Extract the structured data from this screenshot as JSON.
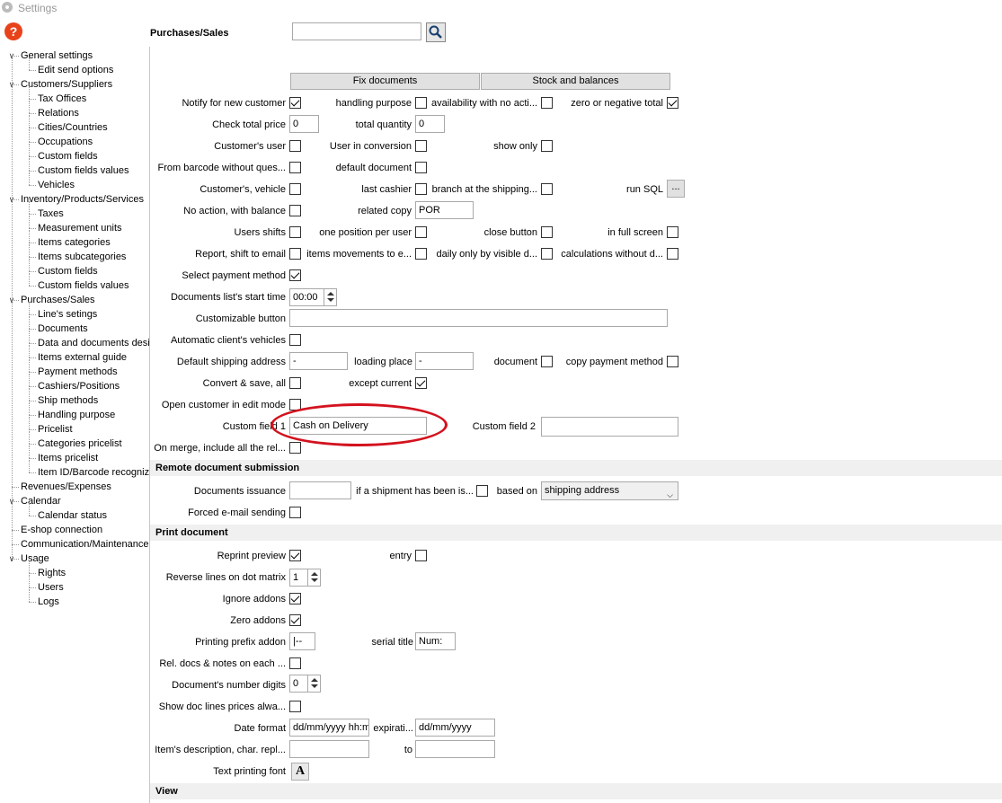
{
  "window": {
    "title": "Settings",
    "help_label": "?"
  },
  "sidebar": {
    "items": [
      {
        "label": "General settings",
        "level": 0,
        "expanded": true
      },
      {
        "label": "Edit send options",
        "level": 1
      },
      {
        "label": "Customers/Suppliers",
        "level": 0,
        "expanded": true
      },
      {
        "label": "Tax Offices",
        "level": 1
      },
      {
        "label": "Relations",
        "level": 1
      },
      {
        "label": "Cities/Countries",
        "level": 1
      },
      {
        "label": "Occupations",
        "level": 1
      },
      {
        "label": "Custom fields",
        "level": 1
      },
      {
        "label": "Custom fields values",
        "level": 1
      },
      {
        "label": "Vehicles",
        "level": 1
      },
      {
        "label": "Inventory/Products/Services",
        "level": 0,
        "expanded": true
      },
      {
        "label": "Taxes",
        "level": 1
      },
      {
        "label": "Measurement units",
        "level": 1
      },
      {
        "label": "Items categories",
        "level": 1
      },
      {
        "label": "Items subcategories",
        "level": 1
      },
      {
        "label": "Custom fields",
        "level": 1
      },
      {
        "label": "Custom fields values",
        "level": 1
      },
      {
        "label": "Purchases/Sales",
        "level": 0,
        "expanded": true
      },
      {
        "label": "Line's setings",
        "level": 1
      },
      {
        "label": "Documents",
        "level": 1
      },
      {
        "label": "Data and documents desi",
        "level": 1
      },
      {
        "label": "Items external guide",
        "level": 1
      },
      {
        "label": "Payment methods",
        "level": 1
      },
      {
        "label": "Cashiers/Positions",
        "level": 1
      },
      {
        "label": "Ship methods",
        "level": 1
      },
      {
        "label": "Handling purpose",
        "level": 1
      },
      {
        "label": "Pricelist",
        "level": 1
      },
      {
        "label": "Categories pricelist",
        "level": 1
      },
      {
        "label": "Items pricelist",
        "level": 1
      },
      {
        "label": "Item ID/Barcode recognize",
        "level": 1
      },
      {
        "label": "Revenues/Expenses",
        "level": 0
      },
      {
        "label": "Calendar",
        "level": 0,
        "expanded": true
      },
      {
        "label": "Calendar status",
        "level": 1
      },
      {
        "label": "E-shop connection",
        "level": 0
      },
      {
        "label": "Communication/Maintenance",
        "level": 0
      },
      {
        "label": "Usage",
        "level": 0,
        "expanded": true
      },
      {
        "label": "Rights",
        "level": 1
      },
      {
        "label": "Users",
        "level": 1
      },
      {
        "label": "Logs",
        "level": 1
      }
    ]
  },
  "header": {
    "title": "Purchases/Sales",
    "search_value": ""
  },
  "buttons": {
    "fix_documents": "Fix documents",
    "stock_and_balances": "Stock and balances",
    "ellipsis": "..."
  },
  "fields": {
    "notify_new_customer": "Notify for new customer",
    "handling_purpose": "handling purpose",
    "availability_no_action": "availability with no acti...",
    "zero_or_negative": "zero or negative total",
    "check_total_price": "Check total price",
    "check_total_price_value": "0",
    "total_quantity": "total quantity",
    "total_quantity_value": "0",
    "customers_user": "Customer's user",
    "user_in_conversion": "User in conversion",
    "show_only": "show only",
    "from_barcode": "From barcode without ques...",
    "default_document": "default document",
    "customers_vehicle": "Customer's, vehicle",
    "last_cashier": "last cashier",
    "branch_at_shipping": "branch at the shipping...",
    "run_sql": "run SQL",
    "no_action_balance": "No action, with balance",
    "related_copy": "related copy",
    "related_copy_value": "POR",
    "users_shifts": "Users shifts",
    "one_position_per_user": "one position per user",
    "close_button": "close button",
    "in_full_screen": "in full screen",
    "report_shift_email": "Report, shift to email",
    "items_movements": "items movements to e...",
    "daily_only_visible": "daily only by visible d...",
    "calculations_without": "calculations without d...",
    "select_payment_method": "Select payment method",
    "docs_list_start_time": "Documents list's start time",
    "docs_list_start_time_value": "00:00",
    "customizable_button": "Customizable button",
    "customizable_button_value": "",
    "automatic_clients_vehicles": "Automatic client's vehicles",
    "default_shipping_address": "Default shipping address",
    "default_shipping_address_value": "-",
    "loading_place": "loading place",
    "loading_place_value": "-",
    "document": "document",
    "copy_payment_method": "copy payment method",
    "convert_save_all": "Convert & save, all",
    "except_current": "except current",
    "open_customer_edit": "Open customer in edit mode",
    "custom_field_1": "Custom field 1",
    "custom_field_1_value": "Cash on Delivery",
    "custom_field_2": "Custom field 2",
    "custom_field_2_value": "",
    "on_merge": "On merge, include all the rel..."
  },
  "remote": {
    "section_title": "Remote document submission",
    "documents_issuance": "Documents issuance",
    "documents_issuance_value": "",
    "if_shipment": "if a shipment has been is...",
    "based_on": "based on",
    "based_on_value": "shipping address",
    "forced_email": "Forced e-mail sending"
  },
  "print": {
    "section_title": "Print document",
    "reprint_preview": "Reprint preview",
    "entry": "entry",
    "reverse_lines": "Reverse lines on dot matrix",
    "reverse_lines_value": "1",
    "ignore_addons": "Ignore addons",
    "zero_addons": "Zero addons",
    "printing_prefix_addon": "Printing prefix addon",
    "printing_prefix_addon_value": "|--",
    "serial_title": "serial title",
    "serial_title_value": "Num:",
    "rel_docs_notes": "Rel. docs & notes on each ...",
    "document_number_digits": "Document's number digits",
    "document_number_digits_value": "0",
    "show_doc_lines_prices": "Show doc lines prices alwa...",
    "date_format": "Date format",
    "date_format_value": "dd/mm/yyyy hh:m",
    "expiration": "expirati...",
    "expiration_value": "dd/mm/yyyy",
    "items_description": "Item's description, char. repl...",
    "items_description_value": "",
    "to": "to",
    "to_value": "",
    "text_printing_font": "Text printing font",
    "font_button": "A"
  },
  "view": {
    "section_title": "View"
  },
  "checkboxes": {
    "notify_new_customer": true,
    "handling_purpose": false,
    "availability_no_action": false,
    "zero_or_negative": true,
    "customers_user": false,
    "user_in_conversion": false,
    "show_only": false,
    "from_barcode": false,
    "default_document": false,
    "customers_vehicle": false,
    "last_cashier": false,
    "branch_at_shipping": false,
    "no_action_balance": false,
    "users_shifts": false,
    "one_position_per_user": false,
    "close_button": false,
    "in_full_screen": false,
    "report_shift_email": false,
    "items_movements": false,
    "daily_only_visible": false,
    "calculations_without": false,
    "select_payment_method": true,
    "automatic_clients_vehicles": false,
    "document": false,
    "copy_payment_method": false,
    "convert_save_all": false,
    "except_current": true,
    "open_customer_edit": false,
    "on_merge": false,
    "if_shipment": false,
    "forced_email": false,
    "reprint_preview": true,
    "entry": false,
    "ignore_addons": true,
    "zero_addons": true,
    "rel_docs_notes": false,
    "show_doc_lines_prices": false
  },
  "annotation": {
    "color": "#d3121e",
    "target": "custom-field-1"
  }
}
